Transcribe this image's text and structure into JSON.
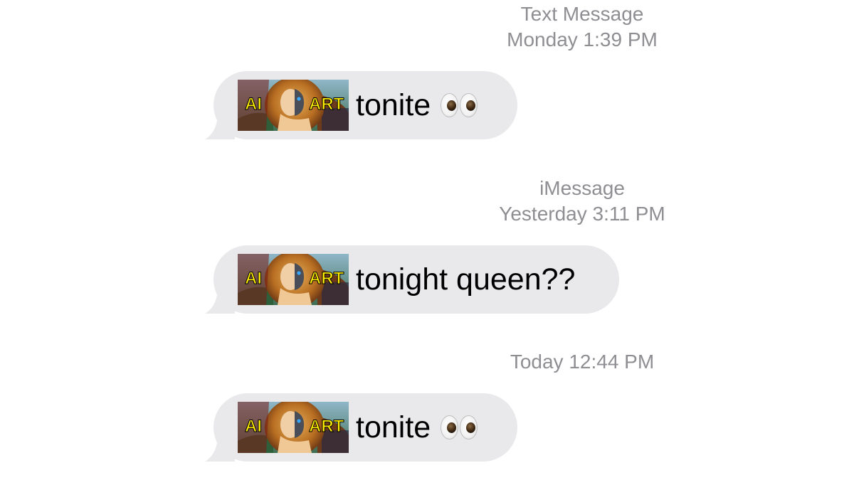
{
  "conversation": {
    "groups": [
      {
        "service": "Text Message",
        "timestamp": "Monday 1:39 PM",
        "message": {
          "sticker": {
            "left_text": "AI",
            "right_text": "ART"
          },
          "text": "tonite",
          "emoji": "eyes-emoji"
        }
      },
      {
        "service": "iMessage",
        "timestamp": "Yesterday 3:11 PM",
        "message": {
          "sticker": {
            "left_text": "AI",
            "right_text": "ART"
          },
          "text": "tonight queen??",
          "emoji": ""
        }
      },
      {
        "service": "",
        "timestamp": "Today 12:44 PM",
        "message": {
          "sticker": {
            "left_text": "AI",
            "right_text": "ART"
          },
          "text": "tonite",
          "emoji": "eyes-emoji"
        }
      }
    ]
  },
  "colors": {
    "bubble_background": "#e9e9eb",
    "timestamp_text": "#8e8e93",
    "message_text": "#000000",
    "sticker_label": "#ffee00"
  }
}
